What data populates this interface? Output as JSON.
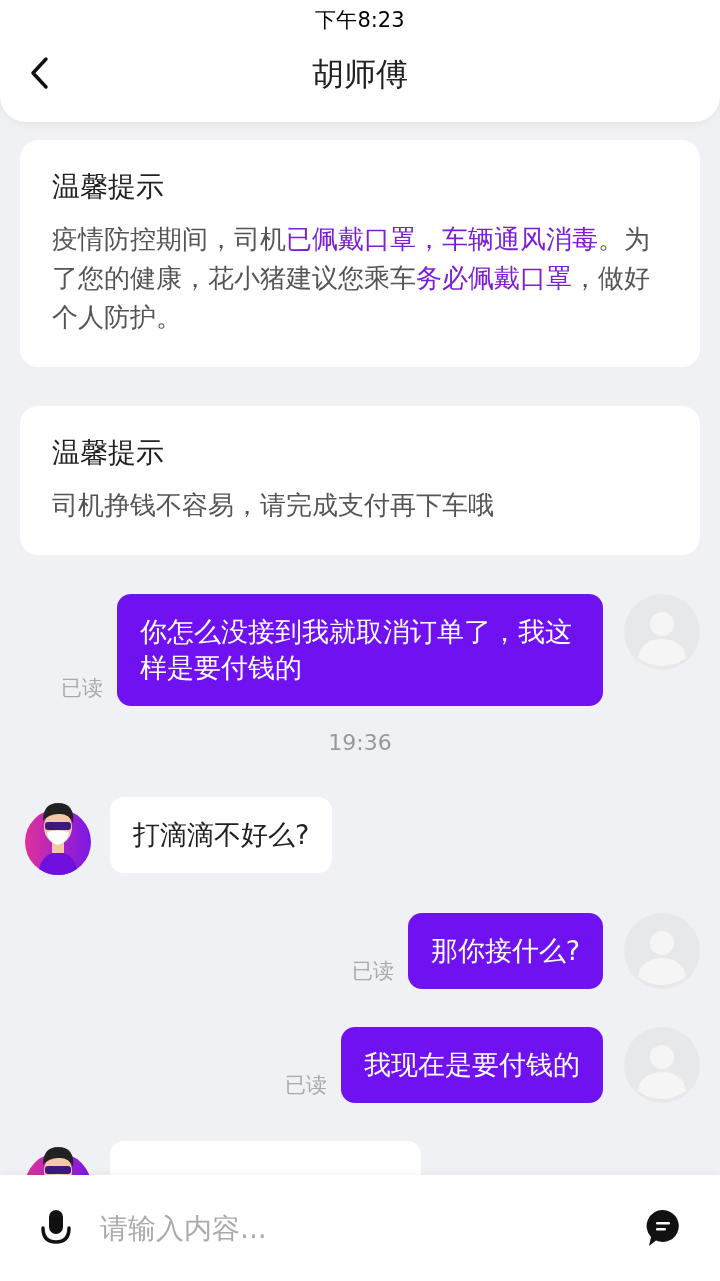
{
  "status_bar": {
    "time": "下午8:23"
  },
  "header": {
    "title": "胡师傅"
  },
  "notices": [
    {
      "title": "温馨提示",
      "body": [
        {
          "text": "疫情防控期间，司机",
          "highlight": false
        },
        {
          "text": "已佩戴口罩，车辆通风消毒",
          "highlight": true
        },
        {
          "text": "。为了您的健康，花小猪建议您乘车",
          "highlight": false
        },
        {
          "text": "务必佩戴口罩",
          "highlight": true
        },
        {
          "text": "，做好个人防护。",
          "highlight": false
        }
      ]
    },
    {
      "title": "温馨提示",
      "body": [
        {
          "text": "司机挣钱不容易，请完成支付再下车哦",
          "highlight": false
        }
      ]
    }
  ],
  "messages": [
    {
      "kind": "outgoing",
      "text": "你怎么没接到我就取消订单了，我这样是要付钱的",
      "status": "已读"
    },
    {
      "kind": "time",
      "text": "19:36"
    },
    {
      "kind": "incoming",
      "text": "打滴滴不好么?"
    },
    {
      "kind": "outgoing",
      "text": "那你接什么?",
      "status": "已读"
    },
    {
      "kind": "outgoing",
      "text": "我现在是要付钱的",
      "status": "已读"
    },
    {
      "kind": "incoming"
    }
  ],
  "input": {
    "placeholder": "请输入内容..."
  }
}
